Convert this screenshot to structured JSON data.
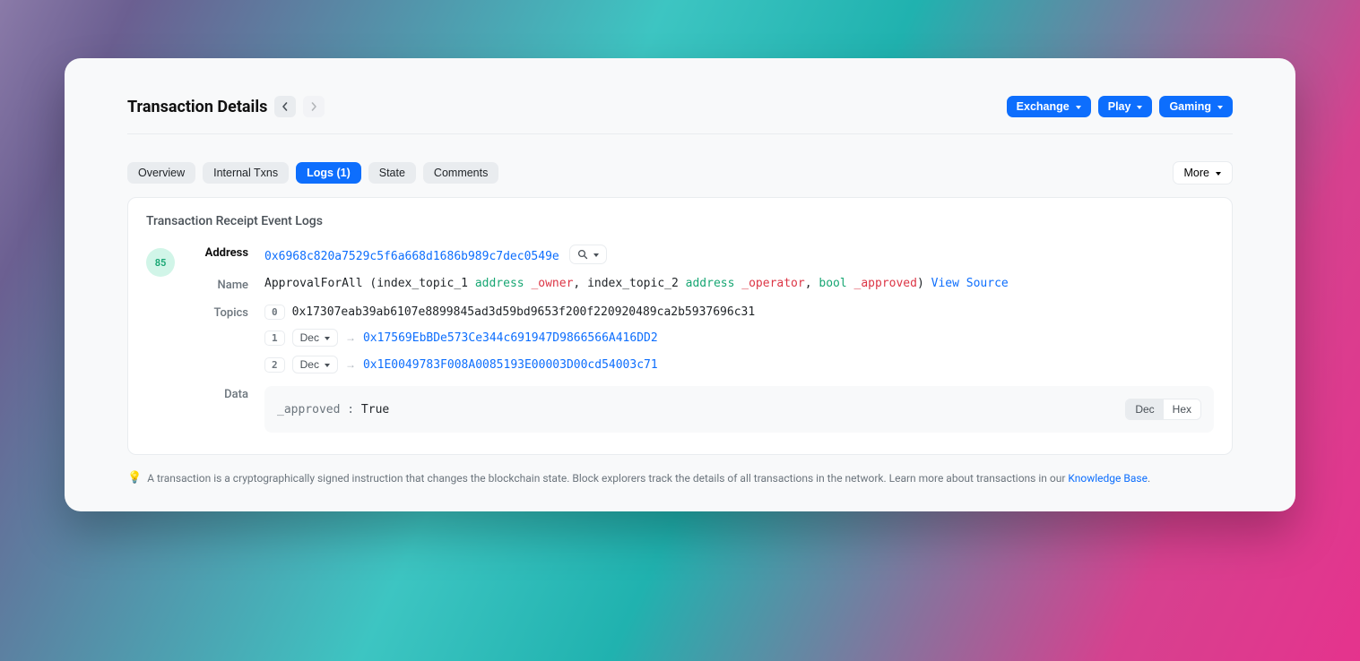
{
  "header": {
    "title": "Transaction Details",
    "actions": {
      "exchange": "Exchange",
      "play": "Play",
      "gaming": "Gaming"
    }
  },
  "tabs": {
    "overview": "Overview",
    "internal": "Internal Txns",
    "logs": "Logs (1)",
    "state": "State",
    "comments": "Comments",
    "more": "More"
  },
  "logs": {
    "section_title": "Transaction Receipt Event Logs",
    "badge": "85",
    "labels": {
      "address": "Address",
      "name": "Name",
      "topics": "Topics",
      "data": "Data"
    },
    "address": "0x6968c820a7529c5f6a668d1686b989c7dec0549e",
    "event": {
      "fn": "ApprovalForAll",
      "p1_prefix": "index_topic_1",
      "p1_type": "address",
      "p1_name": "_owner",
      "p2_prefix": "index_topic_2",
      "p2_type": "address",
      "p2_name": "_operator",
      "p3_type": "bool",
      "p3_name": "_approved",
      "view_source": "View Source"
    },
    "topics": [
      {
        "idx": "0",
        "value": "0x17307eab39ab6107e8899845ad3d59bd9653f200f220920489ca2b5937696c31",
        "dec": null
      },
      {
        "idx": "1",
        "value": "0x17569EbBDe573Ce344c691947D9866566A416DD2",
        "dec": "Dec"
      },
      {
        "idx": "2",
        "value": "0x1E0049783F008A0085193E00003D00cd54003c71",
        "dec": "Dec"
      }
    ],
    "data_row": {
      "label": "_approved :",
      "value": "True",
      "dec": "Dec",
      "hex": "Hex"
    }
  },
  "footer": {
    "text": "A transaction is a cryptographically signed instruction that changes the blockchain state. Block explorers track the details of all transactions in the network. Learn more about transactions in our ",
    "link": "Knowledge Base",
    "period": "."
  }
}
